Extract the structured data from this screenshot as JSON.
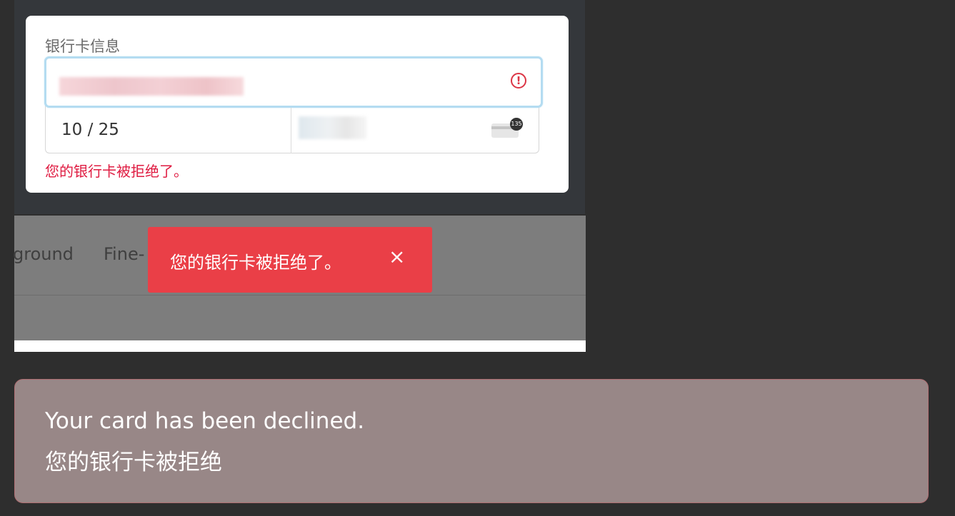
{
  "card_form": {
    "label": "银行卡信息",
    "card_number_value": "",
    "expiry_value": "10 / 25",
    "cvc_value": "",
    "cvc_icon_badge": "135",
    "error_message": "您的银行卡被拒绝了。"
  },
  "background_nav": {
    "items": [
      "ground",
      "Fine-"
    ]
  },
  "toast": {
    "message": "您的银行卡被拒绝了。",
    "close_glyph": "×"
  },
  "translation_note": {
    "english": "Your card has been declined.",
    "chinese": "您的银行卡被拒绝"
  },
  "colors": {
    "error_red": "#df1b41",
    "toast_bg": "#ea3f47",
    "focus_ring": "#b4dcf1",
    "note_bg": "#988787"
  }
}
